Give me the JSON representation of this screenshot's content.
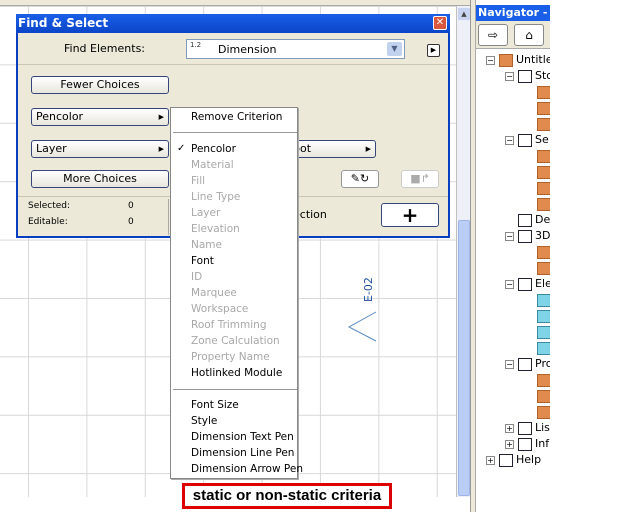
{
  "dialog": {
    "title": "Find & Select",
    "find_elements_label": "Find Elements:",
    "element_type": "Dimension",
    "element_type_icon": "1.2",
    "fewer_choices": "Fewer Choices",
    "criteria": [
      "Pencolor",
      "Layer"
    ],
    "hidden_criterion_suffix": "pot",
    "more_choices": "More Choices",
    "selected_label": "Selected:",
    "selected_value": "0",
    "editable_label": "Editable:",
    "editable_value": "0",
    "selection_partial": "ection",
    "add_label": "+"
  },
  "menu": {
    "remove": "Remove Criterion",
    "group1": [
      {
        "label": "Pencolor",
        "checked": true,
        "enabled": true
      },
      {
        "label": "Material",
        "enabled": false
      },
      {
        "label": "Fill",
        "enabled": false
      },
      {
        "label": "Line Type",
        "enabled": false
      },
      {
        "label": "Layer",
        "enabled": false
      },
      {
        "label": "Elevation",
        "enabled": false
      },
      {
        "label": "Name",
        "enabled": false
      },
      {
        "label": "Font",
        "enabled": true
      },
      {
        "label": "ID",
        "enabled": false
      },
      {
        "label": "Marquee",
        "enabled": false
      },
      {
        "label": "Workspace",
        "enabled": false
      },
      {
        "label": "Roof Trimming",
        "enabled": false
      },
      {
        "label": "Zone Calculation",
        "enabled": false
      },
      {
        "label": "Property Name",
        "enabled": false
      },
      {
        "label": "Hotlinked Module",
        "enabled": true
      }
    ],
    "group2": [
      "Font Size",
      "Style",
      "Dimension Text Pen",
      "Dimension Line Pen",
      "Dimension Arrow Pen"
    ]
  },
  "canvas": {
    "elevation_marker": "E-02"
  },
  "caption": "static or non-static criteria",
  "navigator": {
    "title": "Navigator - P",
    "tree": [
      {
        "label": "Untitle",
        "level": 0,
        "toggle": "-"
      },
      {
        "label": "Sto",
        "level": 1,
        "toggle": "-"
      },
      {
        "label": "",
        "level": 2
      },
      {
        "label": "",
        "level": 2
      },
      {
        "label": "",
        "level": 2
      },
      {
        "label": "Se",
        "level": 1,
        "toggle": "-"
      },
      {
        "label": "",
        "level": 2
      },
      {
        "label": "",
        "level": 2
      },
      {
        "label": "",
        "level": 2
      },
      {
        "label": "",
        "level": 2
      },
      {
        "label": "De",
        "level": 1
      },
      {
        "label": "3D",
        "level": 1,
        "toggle": "-"
      },
      {
        "label": "",
        "level": 2
      },
      {
        "label": "",
        "level": 2
      },
      {
        "label": "Ele",
        "level": 1,
        "toggle": "-"
      },
      {
        "label": "",
        "level": 2
      },
      {
        "label": "",
        "level": 2
      },
      {
        "label": "",
        "level": 2
      },
      {
        "label": "",
        "level": 2
      },
      {
        "label": "Pro",
        "level": 1,
        "toggle": "-"
      },
      {
        "label": "",
        "level": 2
      },
      {
        "label": "",
        "level": 2
      },
      {
        "label": "",
        "level": 2
      },
      {
        "label": "Lis",
        "level": 1,
        "toggle": "+"
      },
      {
        "label": "Inf",
        "level": 1,
        "toggle": "+"
      },
      {
        "label": "Help",
        "level": 0,
        "toggle": "+"
      }
    ]
  }
}
